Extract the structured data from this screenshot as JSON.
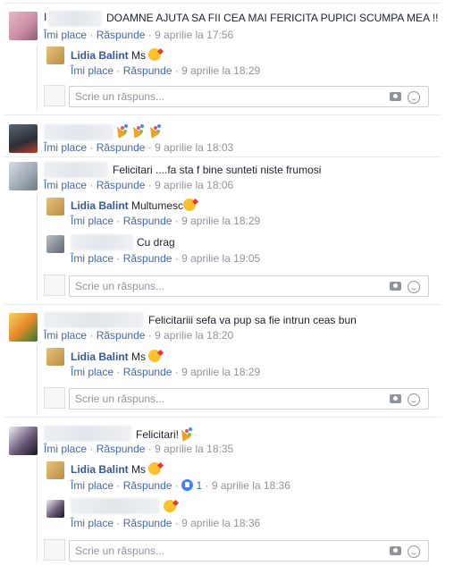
{
  "actions": {
    "like": "Îmi place",
    "reply": "Răspunde",
    "dot": "·"
  },
  "reply_placeholder": "Scrie un răspuns...",
  "comments": [
    {
      "prefix": "I",
      "text": "DOAMNE AJUTA SA FII CEA MAI FERICITA PUPICI SCUMPA MEA !!",
      "date": "9 aprilie la 17:56"
    },
    {
      "text": "",
      "date": "9 aprilie la 18:03"
    },
    {
      "text": "Felicitari ....fa sta f bine sunteti niste frumosi",
      "date": "9 aprilie la 18:06"
    },
    {
      "text": "Felicitariii sefa va pup sa fie intrun ceas bun",
      "date": "9 aprilie la 18:20"
    },
    {
      "text": "Felicitari!",
      "date": "9 aprilie la 18:35"
    }
  ],
  "replies": [
    {
      "name": "Lidia Balint",
      "text": "Ms",
      "date": "9 aprilie la 18:29"
    },
    {
      "name": "Lidia Balint",
      "text": "Multumesc",
      "date": "9 aprilie la 18:29"
    },
    {
      "name": "",
      "text": "Cu drag",
      "date": "9 aprilie la 19:05"
    },
    {
      "name": "Lidia Balint",
      "text": "Ms",
      "date": "9 aprilie la 18:29"
    },
    {
      "name": "Lidia Balint",
      "text": "Ms",
      "date": "9 aprilie la 18:36",
      "likes": "1"
    },
    {
      "name": "",
      "text": "",
      "date": "9 aprilie la 18:36"
    }
  ],
  "colors": {
    "link": "#4267b2",
    "name": "#365899",
    "meta": "#90949c",
    "border": "#ccd0d5"
  },
  "icons": [
    "camera-icon",
    "emoji-icon",
    "like-badge-icon",
    "kiss-emoji-icon",
    "party-popper-icon"
  ]
}
